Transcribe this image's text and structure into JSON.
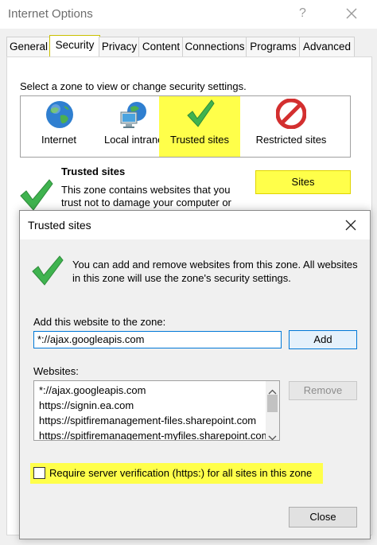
{
  "outer_window": {
    "title": "Internet Options",
    "help": "?",
    "tabs": [
      "General",
      "Security",
      "Privacy",
      "Content",
      "Connections",
      "Programs",
      "Advanced"
    ],
    "active_tab": "Security"
  },
  "security": {
    "instruction": "Select a zone to view or change security settings.",
    "zones": [
      {
        "label": "Internet",
        "icon": "globe-icon"
      },
      {
        "label": "Local intranet",
        "icon": "network-computer-icon"
      },
      {
        "label": "Trusted sites",
        "icon": "green-check-icon"
      },
      {
        "label": "Restricted sites",
        "icon": "no-entry-icon"
      }
    ],
    "zone_heading": "Trusted sites",
    "zone_description_line1": "This zone contains websites that you",
    "zone_description_line2": "trust not to damage your computer or",
    "sites_button": "Sites"
  },
  "dialog": {
    "title": "Trusted sites",
    "info_line1": "You can add and remove websites from this zone. All websites",
    "info_line2": "in this zone will use the zone's security settings.",
    "add_label": "Add this website to the zone:",
    "add_value": "*://ajax.googleapis.com",
    "add_button": "Add",
    "websites_label": "Websites:",
    "websites": [
      "*://ajax.googleapis.com",
      "https://signin.ea.com",
      "https://spitfiremanagement-files.sharepoint.com",
      "https://spitfiremanagement-myfiles.sharepoint.com"
    ],
    "remove_button": "Remove",
    "verify_label": "Require server verification (https:) for all sites in this zone",
    "verify_checked": false,
    "close_button": "Close"
  },
  "colors": {
    "highlight": "#ffff4a",
    "check_green": "#3fb34f",
    "focus_blue": "#0078d7"
  }
}
